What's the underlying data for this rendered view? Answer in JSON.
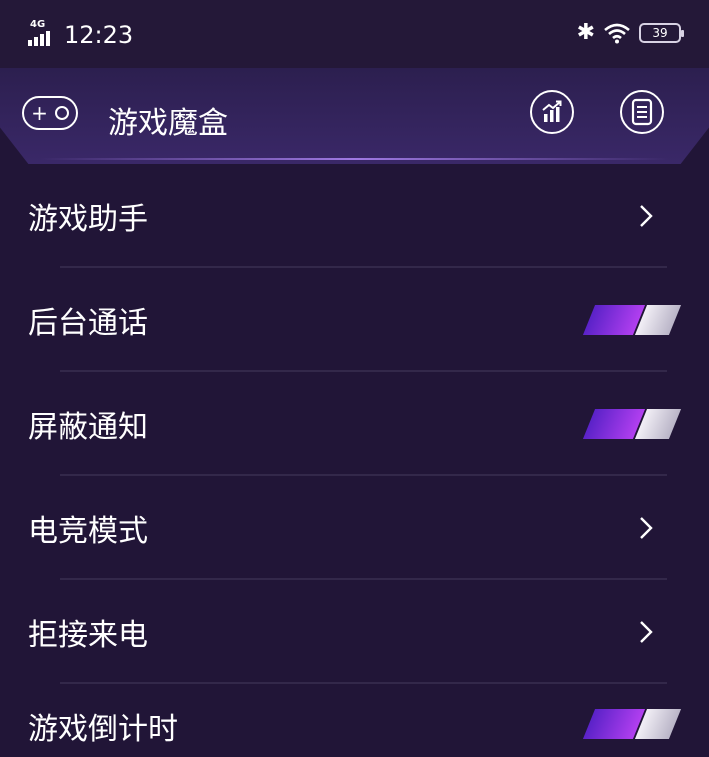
{
  "status_bar": {
    "network": "4G",
    "time": "12:23",
    "battery": "39",
    "icons": [
      "signal-icon",
      "bluetooth-icon",
      "wifi-icon",
      "battery-icon"
    ]
  },
  "header": {
    "title": "游戏魔盒",
    "icons": [
      "gamepad-icon",
      "stats-icon",
      "notes-icon"
    ]
  },
  "menu": {
    "items": [
      {
        "label": "游戏助手",
        "control": "chevron"
      },
      {
        "label": "后台通话",
        "control": "toggle",
        "on": true
      },
      {
        "label": "屏蔽通知",
        "control": "toggle",
        "on": true
      },
      {
        "label": "电竞模式",
        "control": "chevron"
      },
      {
        "label": "拒接来电",
        "control": "chevron"
      },
      {
        "label": "游戏倒计时",
        "control": "toggle",
        "on": true
      }
    ]
  },
  "colors": {
    "background": "#211537",
    "header": "#33245c",
    "toggle_accent": "#a53cf0",
    "toggle_knob": "#e6e2ee",
    "text": "#ffffff"
  }
}
